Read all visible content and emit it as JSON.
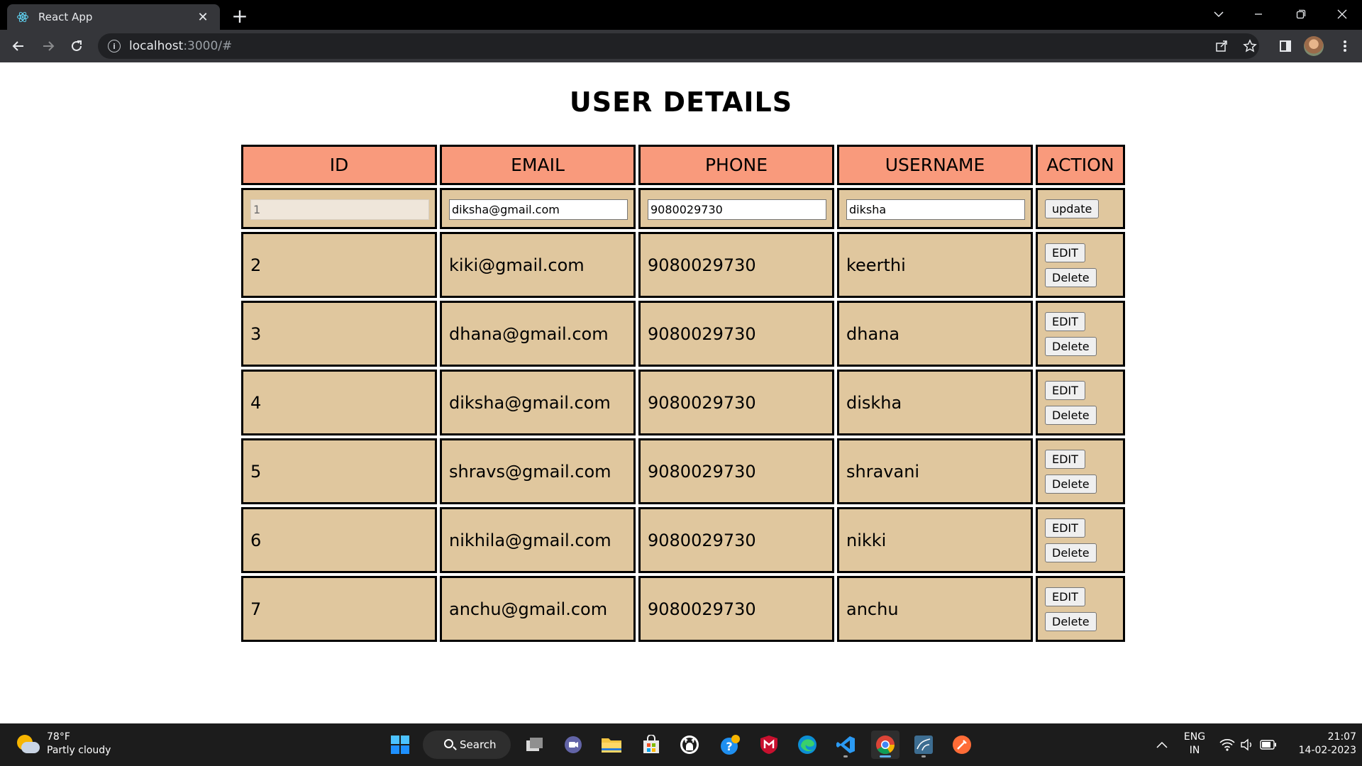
{
  "browser": {
    "tab_title": "React App",
    "url_host": "localhost",
    "url_path": ":3000/#"
  },
  "page": {
    "title": "USER DETAILS"
  },
  "table": {
    "headers": [
      "ID",
      "EMAIL",
      "PHONE",
      "USERNAME",
      "ACTION"
    ],
    "edit_row": {
      "id": "1",
      "email": "diksha@gmail.com",
      "phone": "9080029730",
      "username": "diksha",
      "update_label": "update"
    },
    "rows": [
      {
        "id": "2",
        "email": "kiki@gmail.com",
        "phone": "9080029730",
        "username": "keerthi"
      },
      {
        "id": "3",
        "email": "dhana@gmail.com",
        "phone": "9080029730",
        "username": "dhana"
      },
      {
        "id": "4",
        "email": "diksha@gmail.com",
        "phone": "9080029730",
        "username": "diskha"
      },
      {
        "id": "5",
        "email": "shravs@gmail.com",
        "phone": "9080029730",
        "username": "shravani"
      },
      {
        "id": "6",
        "email": "nikhila@gmail.com",
        "phone": "9080029730",
        "username": "nikki"
      },
      {
        "id": "7",
        "email": "anchu@gmail.com",
        "phone": "9080029730",
        "username": "anchu"
      }
    ],
    "edit_label": "EDIT",
    "delete_label": "Delete"
  },
  "taskbar": {
    "weather_temp": "78°F",
    "weather_desc": "Partly cloudy",
    "search_label": "Search",
    "lang_line1": "ENG",
    "lang_line2": "IN",
    "time": "21:07",
    "date": "14-02-2023"
  },
  "colors": {
    "header_bg": "#f99a7c",
    "cell_bg": "#e0c79e",
    "border": "#000000"
  }
}
